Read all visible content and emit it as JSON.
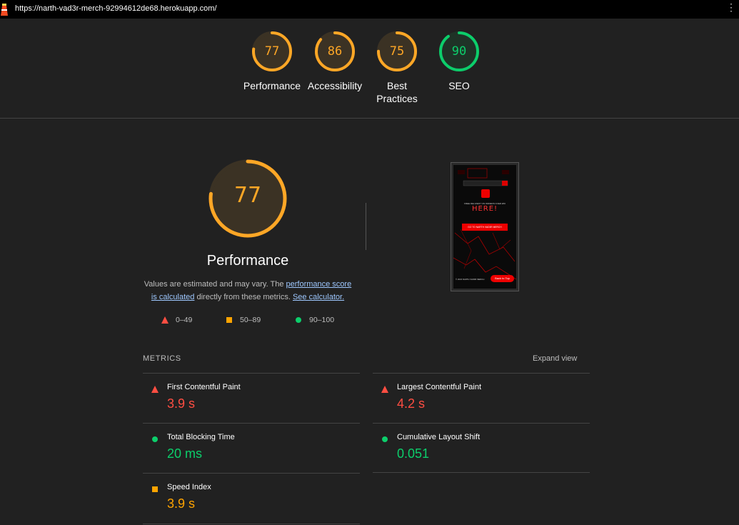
{
  "browser": {
    "url": "https://narth-vad3r-merch-92994612de68.herokuapp.com/",
    "more_icon": "more-vertical-icon",
    "logo_icon": "lighthouse-icon"
  },
  "summary_gauges": [
    {
      "label": "Performance",
      "score": "77",
      "value": 77,
      "color": "#ffa726"
    },
    {
      "label": "Accessibility",
      "score": "86",
      "value": 86,
      "color": "#ffa726"
    },
    {
      "label": "Best Practices",
      "score": "75",
      "value": 75,
      "color": "#ffa726"
    },
    {
      "label": "SEO",
      "score": "90",
      "value": 90,
      "color": "#0cce6b"
    }
  ],
  "performance": {
    "score": "77",
    "value": 77,
    "title": "Performance",
    "desc_prefix": "Values are estimated and may vary. The ",
    "link_score": "performance score is calculated",
    "desc_mid": " directly from these metrics. ",
    "link_calc": "See calculator."
  },
  "legend": [
    {
      "range": "0–49",
      "shape": "triangle",
      "color": "#ff4e42"
    },
    {
      "range": "50–89",
      "shape": "square",
      "color": "#ffa400"
    },
    {
      "range": "90–100",
      "shape": "circle",
      "color": "#0cce6b"
    }
  ],
  "screenshot": {
    "top_text": "FREE DELIVERY ON ORDERS OVER £50",
    "headline": "HERE!",
    "cta": "GO TO NARTH VAD3R MERCH",
    "footer_left": "© 2023 NARTH VAD3R MERCH",
    "back_to_top": "Back to Top"
  },
  "metrics": {
    "heading": "METRICS",
    "expand_label": "Expand view",
    "items": [
      {
        "name": "First Contentful Paint",
        "value": "3.9 s",
        "status": "red"
      },
      {
        "name": "Largest Contentful Paint",
        "value": "4.2 s",
        "status": "red"
      },
      {
        "name": "Total Blocking Time",
        "value": "20 ms",
        "status": "green"
      },
      {
        "name": "Cumulative Layout Shift",
        "value": "0.051",
        "status": "green"
      },
      {
        "name": "Speed Index",
        "value": "3.9 s",
        "status": "orange"
      }
    ]
  }
}
